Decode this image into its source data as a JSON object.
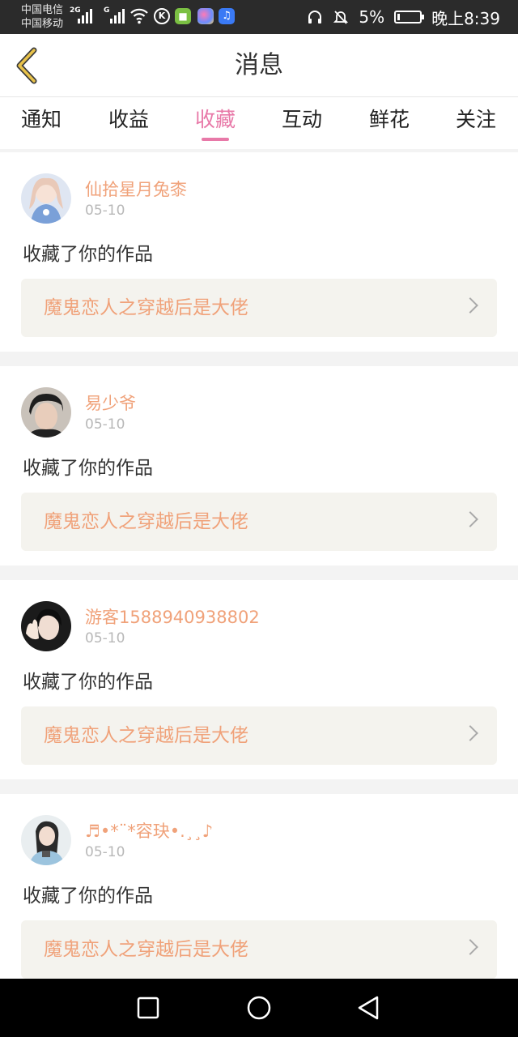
{
  "status_bar": {
    "carrier_1": "中国电信",
    "carrier_2": "中国移动",
    "net_1": "2G",
    "net_2": "G",
    "battery_percent": "5%",
    "time": "晚上8:39"
  },
  "header": {
    "title": "消息"
  },
  "tabs": [
    {
      "label": "通知",
      "active": false
    },
    {
      "label": "收益",
      "active": false
    },
    {
      "label": "收藏",
      "active": true
    },
    {
      "label": "互动",
      "active": false
    },
    {
      "label": "鲜花",
      "active": false
    },
    {
      "label": "关注",
      "active": false
    }
  ],
  "messages": [
    {
      "username": "仙拾星月兔桼",
      "date": "05-10",
      "action": "收藏了你的作品",
      "work_title": "魔鬼恋人之穿越后是大佬"
    },
    {
      "username": "易少爷",
      "date": "05-10",
      "action": "收藏了你的作品",
      "work_title": "魔鬼恋人之穿越后是大佬"
    },
    {
      "username": "游客1588940938802",
      "date": "05-10",
      "action": "收藏了你的作品",
      "work_title": "魔鬼恋人之穿越后是大佬"
    },
    {
      "username": "♬•*¨*容玦•.¸¸♪",
      "date": "05-10",
      "action": "收藏了你的作品",
      "work_title": "魔鬼恋人之穿越后是大佬"
    }
  ],
  "colors": {
    "accent": "#e879a8",
    "username": "#f0a27a",
    "back_arrow": "#e8c24a"
  }
}
